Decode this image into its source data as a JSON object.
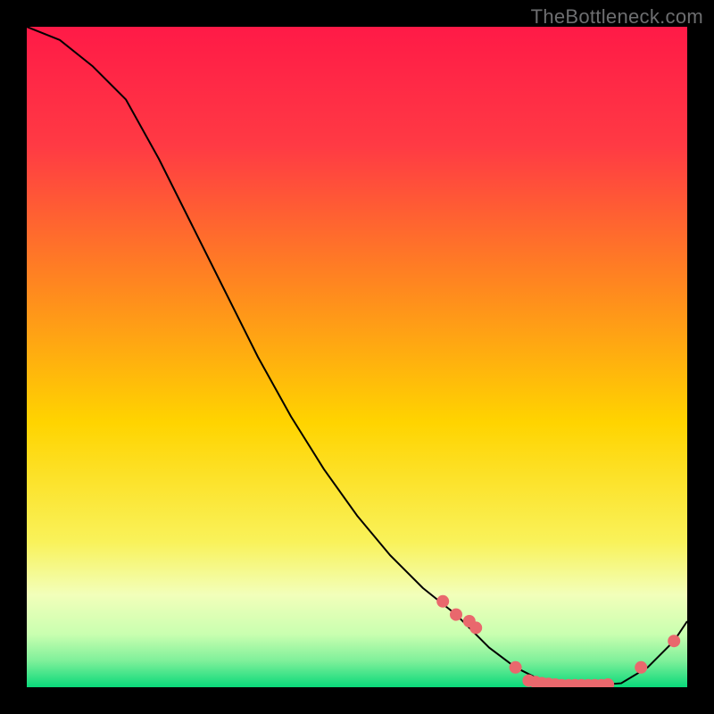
{
  "watermark": "TheBottleneck.com",
  "chart_data": {
    "type": "line",
    "title": "",
    "xlabel": "",
    "ylabel": "",
    "xlim": [
      0,
      100
    ],
    "ylim": [
      0,
      100
    ],
    "grid": false,
    "legend": false,
    "background_gradient": {
      "top_color": "#ff1a47",
      "mid_high_color": "#ff9a00",
      "mid_low_color": "#ffe400",
      "low_color": "#f6ffcc",
      "bottom_color": "#09d97a"
    },
    "series": [
      {
        "name": "curve",
        "type": "line",
        "color": "#000000",
        "x": [
          0,
          5,
          10,
          15,
          20,
          25,
          30,
          35,
          40,
          45,
          50,
          55,
          60,
          65,
          70,
          74,
          78,
          82,
          86,
          90,
          94,
          98,
          100
        ],
        "y": [
          100,
          98,
          94,
          89,
          80,
          70,
          60,
          50,
          41,
          33,
          26,
          20,
          15,
          11,
          6,
          3,
          1,
          0.5,
          0.3,
          0.6,
          3,
          7,
          10
        ]
      },
      {
        "name": "markers",
        "type": "scatter",
        "color": "#e9686d",
        "x": [
          63,
          65,
          67,
          68,
          74,
          76,
          77,
          78,
          79,
          80,
          81,
          82,
          83,
          84,
          85,
          86,
          87,
          88,
          93,
          98
        ],
        "y": [
          13,
          11,
          10,
          9,
          3,
          1,
          0.8,
          0.6,
          0.5,
          0.4,
          0.3,
          0.3,
          0.3,
          0.3,
          0.3,
          0.3,
          0.3,
          0.4,
          3,
          7
        ]
      }
    ]
  }
}
